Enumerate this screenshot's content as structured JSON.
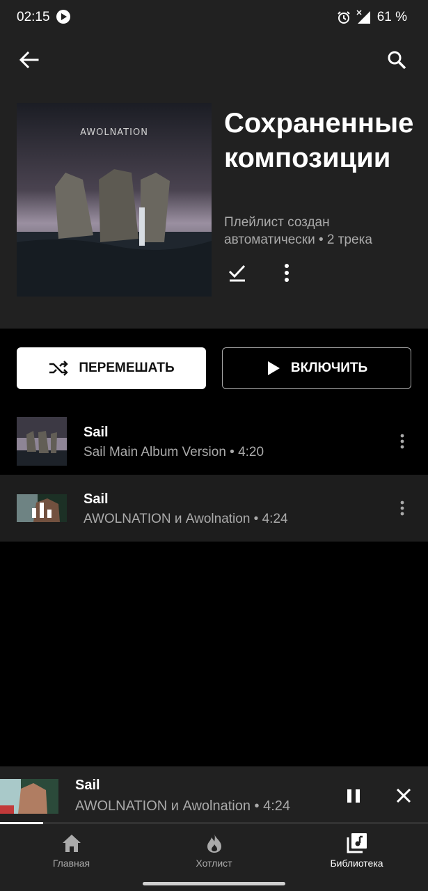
{
  "status_bar": {
    "time": "02:15",
    "battery": "61 %"
  },
  "playlist": {
    "title": "Сохраненные композиции",
    "subtitle": "Плейлист создан автоматически • 2 трека",
    "cover_brand": "AWOLNATION"
  },
  "actions": {
    "shuffle_label": "ПЕРЕМЕШАТЬ",
    "play_label": "ВКЛЮЧИТЬ"
  },
  "tracks": [
    {
      "title": "Sail",
      "subtitle": "Sail Main Album Version • 4:20",
      "playing": false
    },
    {
      "title": "Sail",
      "subtitle": "AWOLNATION и Awolnation • 4:24",
      "playing": true
    }
  ],
  "now_playing": {
    "title": "Sail",
    "subtitle": "AWOLNATION и Awolnation • 4:24",
    "progress": 0.1
  },
  "bottom_nav": [
    {
      "label": "Главная",
      "icon": "home-icon",
      "active": false
    },
    {
      "label": "Хотлист",
      "icon": "flame-icon",
      "active": false
    },
    {
      "label": "Библиотека",
      "icon": "library-icon",
      "active": true
    }
  ],
  "colors": {
    "background": "#000000",
    "surface": "#212121",
    "secondary_text": "#aaaaaa"
  }
}
